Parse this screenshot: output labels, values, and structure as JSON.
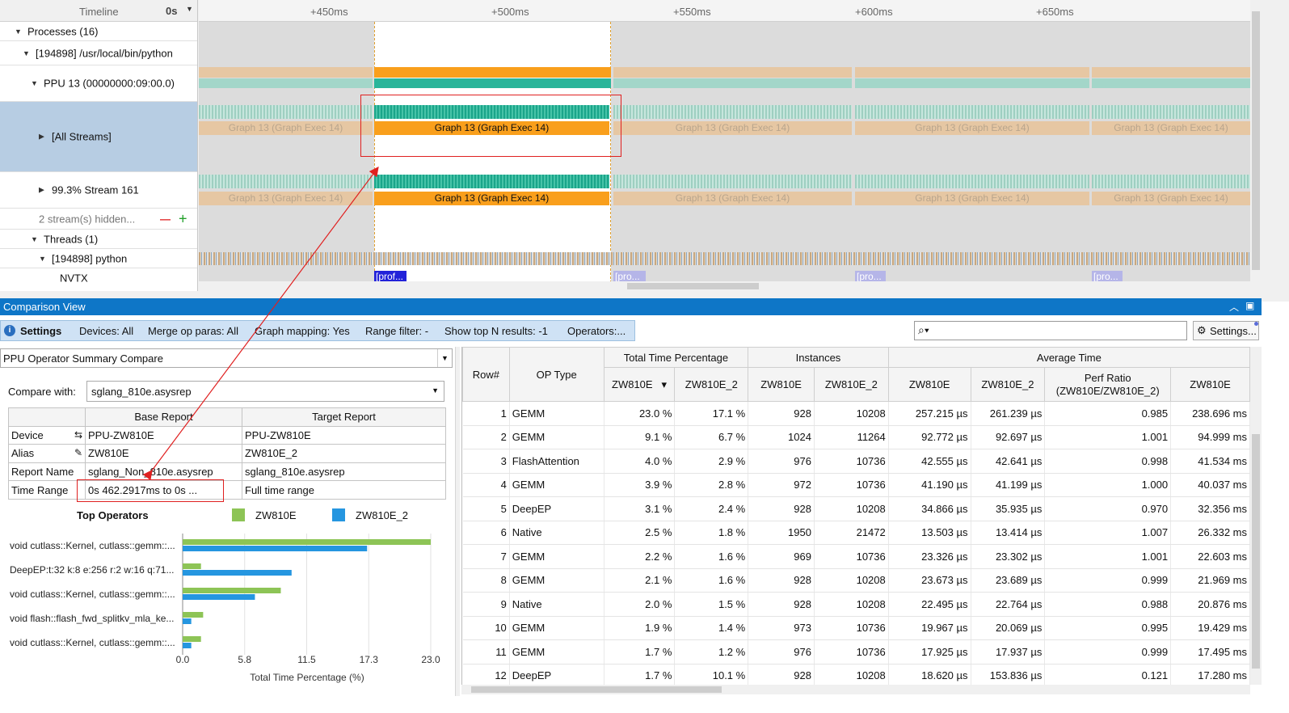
{
  "timeline": {
    "title": "Timeline",
    "zoom": "0s",
    "ticks": [
      "+450ms",
      "+500ms",
      "+550ms",
      "+600ms",
      "+650ms"
    ],
    "tree": [
      {
        "label": "Processes (16)",
        "expanded": true
      },
      {
        "label": "[194898] /usr/local/bin/python",
        "expanded": true
      },
      {
        "label": "PPU 13 (00000000:09:00.0)",
        "expanded": true
      },
      {
        "label": "[All Streams]",
        "expanded": false,
        "selected": true
      },
      {
        "label": "99.3% Stream 161",
        "expanded": false
      },
      {
        "label": "2 stream(s) hidden...",
        "remove": "—",
        "add": "+"
      },
      {
        "label": "Threads (1)",
        "expanded": true
      },
      {
        "label": "[194898] python",
        "expanded": true
      },
      {
        "label": "NVTX"
      }
    ],
    "graph_label": "Graph 13 (Graph Exec 14)",
    "nvtx_label": "[prof...",
    "nvtx_label_off": "[pro..."
  },
  "comparison": {
    "title": "Comparison View",
    "toolbar": {
      "settings": "Settings",
      "devices": "Devices: All",
      "merge": "Merge op paras: All",
      "graph_mapping": "Graph mapping: Yes",
      "range_filter": "Range filter: -",
      "top_n": "Show top N results: -1",
      "operators": "Operators:..."
    },
    "search_placeholder": "",
    "settings_button": "Settings..."
  },
  "left_panel": {
    "view_select": "PPU Operator Summary Compare",
    "compare_with_label": "Compare with:",
    "compare_with_value": "sglang_810e.asysrep",
    "report_table": {
      "headers": [
        "",
        "Base Report",
        "Target Report"
      ],
      "rows": [
        {
          "label": "Device",
          "icon": "swap-icon",
          "base": "PPU-ZW810E",
          "target": "PPU-ZW810E"
        },
        {
          "label": "Alias",
          "icon": "edit-icon",
          "base": "ZW810E",
          "target": "ZW810E_2"
        },
        {
          "label": "Report Name",
          "base": "sglang_Non_810e.asysrep",
          "target": "sglang_810e.asysrep"
        },
        {
          "label": "Time Range",
          "base": "0s 462.2917ms to 0s ...",
          "target": "Full time range"
        }
      ]
    }
  },
  "chart_data": {
    "type": "bar",
    "orientation": "horizontal",
    "title": "Top Operators",
    "categories": [
      "void cutlass::Kernel, cutlass::gemm::...",
      "DeepEP:t:32 k:8 e:256 r:2 w:16 q:71...",
      "void cutlass::Kernel, cutlass::gemm::...",
      "void flash::flash_fwd_splitkv_mla_ke...",
      "void cutlass::Kernel, cutlass::gemm::..."
    ],
    "series": [
      {
        "name": "ZW810E",
        "color": "#8dc456",
        "values": [
          23.0,
          1.7,
          9.1,
          1.9,
          1.7
        ]
      },
      {
        "name": "ZW810E_2",
        "color": "#2596e0",
        "values": [
          17.1,
          10.1,
          6.7,
          0.8,
          0.8
        ]
      }
    ],
    "xticks": [
      "0.0",
      "5.8",
      "11.5",
      "17.3",
      "23.0"
    ],
    "xlim": [
      0,
      23.0
    ],
    "xlabel": "Total Time Percentage (%)"
  },
  "grid": {
    "group_headers": [
      "Total Time Percentage",
      "Instances",
      "Average Time"
    ],
    "headers": [
      "Row#",
      "OP Type",
      "ZW810E",
      "ZW810E_2",
      "ZW810E",
      "ZW810E_2",
      "ZW810E",
      "ZW810E_2",
      "Perf Ratio\n(ZW810E/ZW810E_2)",
      "ZW810E"
    ],
    "sort_indicator": "▾",
    "rows": [
      [
        "1",
        "GEMM",
        "23.0 %",
        "17.1 %",
        "928",
        "10208",
        "257.215 µs",
        "261.239 µs",
        "0.985",
        "238.696 ms"
      ],
      [
        "2",
        "GEMM",
        "9.1 %",
        "6.7 %",
        "1024",
        "11264",
        "92.772 µs",
        "92.697 µs",
        "1.001",
        "94.999 ms"
      ],
      [
        "3",
        "FlashAttention",
        "4.0 %",
        "2.9 %",
        "976",
        "10736",
        "42.555 µs",
        "42.641 µs",
        "0.998",
        "41.534 ms"
      ],
      [
        "4",
        "GEMM",
        "3.9 %",
        "2.8 %",
        "972",
        "10736",
        "41.190 µs",
        "41.199 µs",
        "1.000",
        "40.037 ms"
      ],
      [
        "5",
        "DeepEP",
        "3.1 %",
        "2.4 %",
        "928",
        "10208",
        "34.866 µs",
        "35.935 µs",
        "0.970",
        "32.356 ms"
      ],
      [
        "6",
        "Native",
        "2.5 %",
        "1.8 %",
        "1950",
        "21472",
        "13.503 µs",
        "13.414 µs",
        "1.007",
        "26.332 ms"
      ],
      [
        "7",
        "GEMM",
        "2.2 %",
        "1.6 %",
        "969",
        "10736",
        "23.326 µs",
        "23.302 µs",
        "1.001",
        "22.603 ms"
      ],
      [
        "8",
        "GEMM",
        "2.1 %",
        "1.6 %",
        "928",
        "10208",
        "23.673 µs",
        "23.689 µs",
        "0.999",
        "21.969 ms"
      ],
      [
        "9",
        "Native",
        "2.0 %",
        "1.5 %",
        "928",
        "10208",
        "22.495 µs",
        "22.764 µs",
        "0.988",
        "20.876 ms"
      ],
      [
        "10",
        "GEMM",
        "1.9 %",
        "1.4 %",
        "973",
        "10736",
        "19.967 µs",
        "20.069 µs",
        "0.995",
        "19.429 ms"
      ],
      [
        "11",
        "GEMM",
        "1.7 %",
        "1.2 %",
        "976",
        "10736",
        "17.925 µs",
        "17.937 µs",
        "0.999",
        "17.495 ms"
      ],
      [
        "12",
        "DeepEP",
        "1.7 %",
        "10.1 %",
        "928",
        "10208",
        "18.620 µs",
        "153.836 µs",
        "0.121",
        "17.280 ms"
      ]
    ]
  },
  "colors": {
    "accent": "#0e76c7",
    "highlight": "#e02020",
    "graph_active": "#f99f1c",
    "kernel_active": "#2ab59a"
  }
}
